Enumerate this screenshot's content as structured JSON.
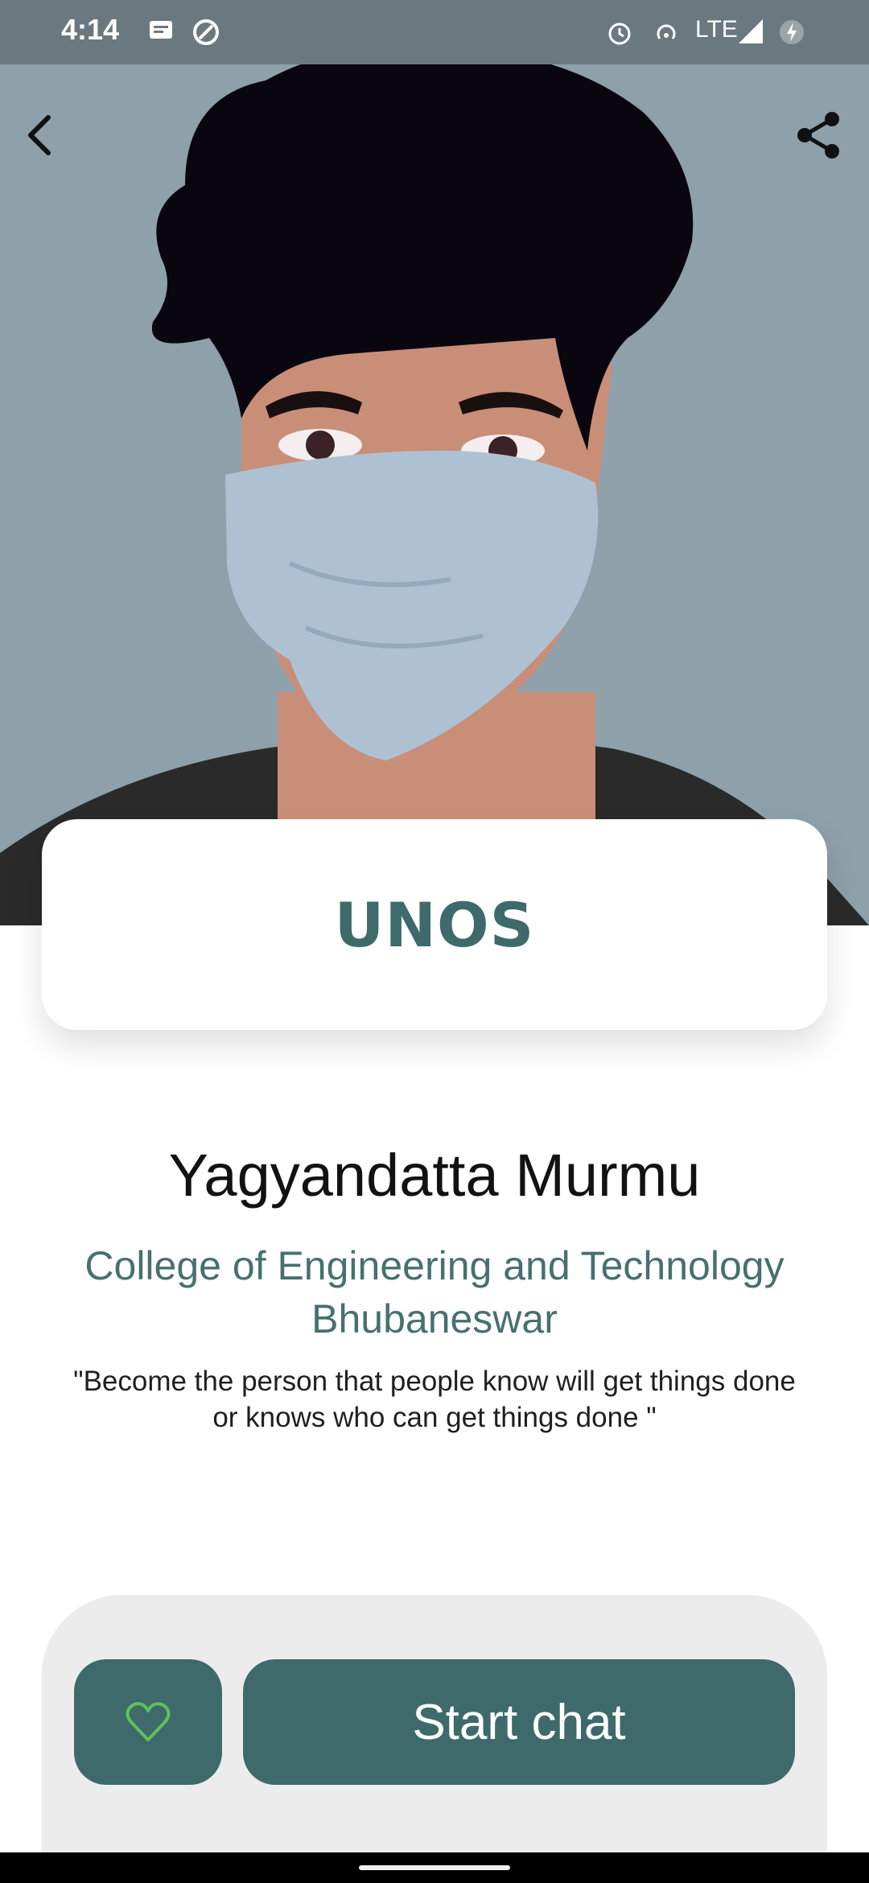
{
  "status_bar": {
    "time": "4:14",
    "network": "LTE",
    "icons": [
      "message-icon",
      "sync-icon",
      "alarm-icon",
      "hotspot-icon",
      "signal-icon",
      "battery-charging-icon"
    ]
  },
  "header": {
    "back_icon": "chevron-left-icon",
    "share_icon": "share-icon"
  },
  "title_card": {
    "title": "UNOS"
  },
  "profile": {
    "name": "Yagyandatta Murmu",
    "college_line1": "College of Engineering and Technology",
    "college_line2": "Bhubaneswar",
    "quote_line1": "\"Become the person that people know will get things done",
    "quote_line2": "or knows who can get things done \""
  },
  "actions": {
    "favorite_icon": "heart-outline-icon",
    "start_chat_label": "Start chat"
  },
  "colors": {
    "accent": "#3e6a6b",
    "hero_bg": "#8ea0aa",
    "panel_bg": "#ececec",
    "heart": "#5cc25a"
  }
}
